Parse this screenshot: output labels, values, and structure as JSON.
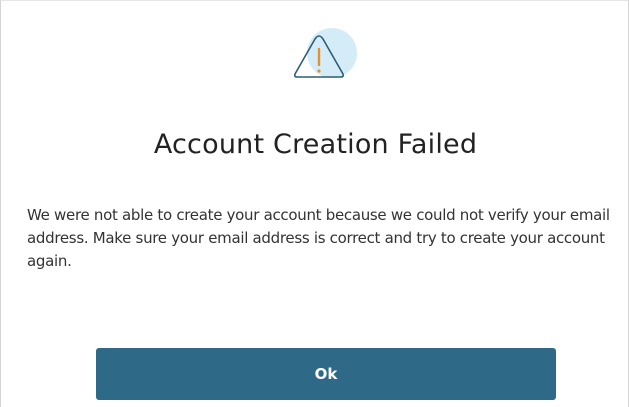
{
  "dialog": {
    "icon": "warning-triangle-icon",
    "title": "Account Creation Failed",
    "message": "We were not able to create your account because we could not verify your email address. Make sure your email address is correct and try to create your account again.",
    "ok_label": "Ok"
  },
  "colors": {
    "button": "#2e6a88",
    "icon_background": "#d4ecf7",
    "icon_outline": "#2f5d73",
    "icon_exclamation": "#e8902a"
  }
}
